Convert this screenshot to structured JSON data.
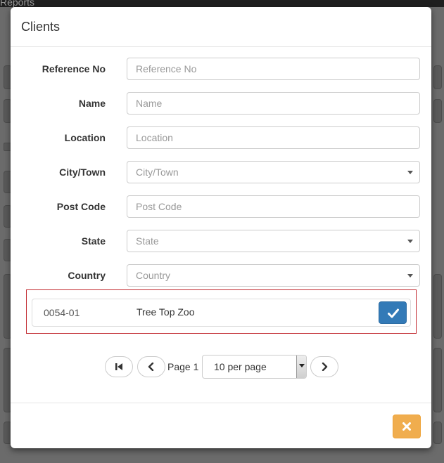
{
  "background": {
    "menu_text": "Reports"
  },
  "modal": {
    "title": "Clients",
    "fields": [
      {
        "label": "Reference No",
        "placeholder": "Reference No",
        "type": "text"
      },
      {
        "label": "Name",
        "placeholder": "Name",
        "type": "text"
      },
      {
        "label": "Location",
        "placeholder": "Location",
        "type": "text"
      },
      {
        "label": "City/Town",
        "placeholder": "City/Town",
        "type": "select"
      },
      {
        "label": "Post Code",
        "placeholder": "Post Code",
        "type": "text"
      },
      {
        "label": "State",
        "placeholder": "State",
        "type": "select"
      },
      {
        "label": "Country",
        "placeholder": "Country",
        "type": "select"
      }
    ],
    "results": [
      {
        "ref": "0054-01",
        "name": "Tree Top Zoo"
      }
    ],
    "pager": {
      "page_label": "Page 1",
      "per_page": "10 per page"
    },
    "icons": {
      "select": "check-icon",
      "first": "first-page-icon",
      "prev": "chevron-left-icon",
      "next": "chevron-right-icon",
      "close": "close-icon"
    },
    "colors": {
      "primary": "#337ab7",
      "warning": "#f0ad4e",
      "highlight_border": "#c1272d"
    }
  }
}
